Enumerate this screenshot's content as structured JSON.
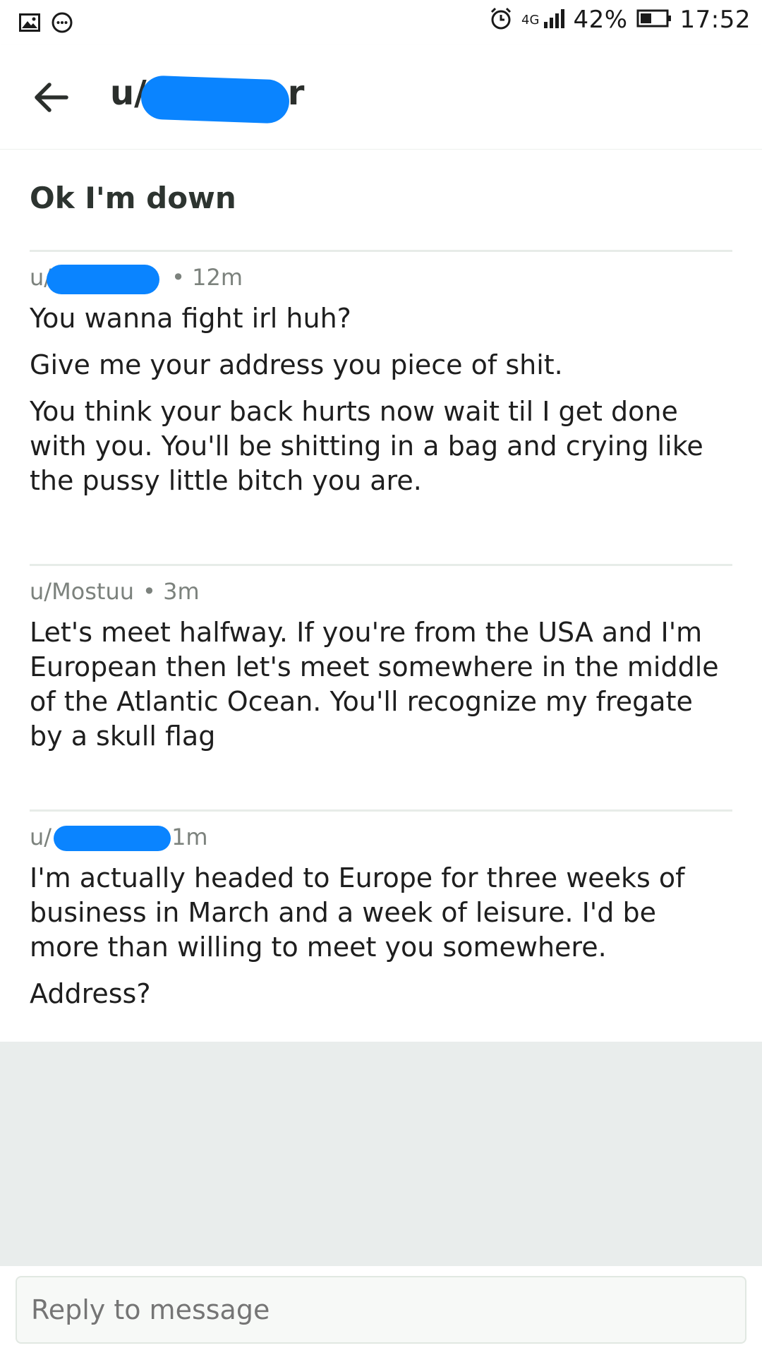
{
  "status_bar": {
    "network": "4G",
    "battery": "42%",
    "time": "17:52",
    "icons": [
      "image-icon",
      "chat-icon",
      "alarm-icon",
      "signal-icon",
      "battery-icon"
    ]
  },
  "app_bar": {
    "title": "u/",
    "title_suffix": "r"
  },
  "thread": {
    "subject": "Ok I'm down",
    "messages": [
      {
        "author": "u/",
        "age": "• 12m",
        "paragraphs": [
          "You wanna fight irl huh?",
          "Give me your address you piece of shit.",
          "You think your back hurts now wait til I get done with you. You'll be shitting in a bag and crying like the pussy little bitch you are."
        ]
      },
      {
        "author": "u/Mostuu",
        "age": "• 3m",
        "paragraphs": [
          "Let's meet halfway. If you're from the USA and I'm European then let's meet somewhere in the middle of the Atlantic Ocean. You'll recognize my fregate by a skull flag"
        ]
      },
      {
        "author": "u/",
        "age": "1m",
        "paragraphs": [
          "I'm actually headed to Europe for three weeks of business in March and a week of leisure. I'd be more than willing to meet you somewhere.",
          "Address?"
        ]
      }
    ]
  },
  "reply": {
    "placeholder": "Reply to message"
  },
  "colors": {
    "redaction": "#0a84ff",
    "divider": "#e7ece8",
    "empty_area": "#e9edec"
  }
}
